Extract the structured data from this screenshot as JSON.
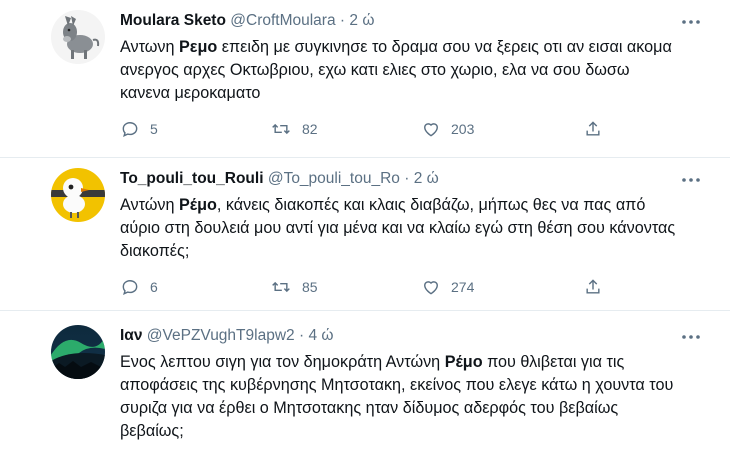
{
  "tweets": [
    {
      "name": "Moulara Sketo",
      "handle": "@CroftMoulara",
      "time": "2 ώ",
      "text_before": "Αντωνη ",
      "text_bold": "Ρεμο",
      "text_after": " επειδη με συγκινησε το δραμα σου να ξερεις οτι αν εισαι ακομα ανεργος αρχες Οκτωβριου, εχω κατι ελιες στο χωριο, ελα να σου δωσω κανενα μεροκαματο",
      "replies": "5",
      "retweets": "82",
      "likes": "203"
    },
    {
      "name": "To_pouli_tou_Rouli",
      "handle": "@To_pouli_tou_Ro",
      "time": "2 ώ",
      "text_before": "Αντώνη ",
      "text_bold": "Ρέμο",
      "text_after": ", κάνεις διακοπές και κλαις διαβάζω, μήπως θες να πας από αύριο στη δουλειά μου αντί για μένα και να κλαίω εγώ στη θέση σου κάνοντας διακοπές;",
      "replies": "6",
      "retweets": "85",
      "likes": "274"
    },
    {
      "name": "Ιαν",
      "handle": "@VePZVughT9lapw2",
      "time": "4 ώ",
      "text_before": "Ενος λεπτου σιγη για τον δημοκράτη Αντώνη ",
      "text_bold": "Ρέμο",
      "text_after": " που  θλιβεται για τις αποφάσεις της κυβέρνησης Μητσοτακη, εκείνος που ελεγε κάτω η χουντα του συριζα για να έρθει ο Μητσοτακης ηταν δίδυμος αδερφός του βεβαίως βεβαίως;"
    }
  ],
  "icons": {
    "more": "more-horizontal-icon",
    "reply": "reply-icon",
    "retweet": "retweet-icon",
    "like": "like-icon",
    "share": "share-icon"
  },
  "colors": {
    "text": "#0f1419",
    "muted": "#5b7083",
    "divider": "#e6ecf0"
  }
}
